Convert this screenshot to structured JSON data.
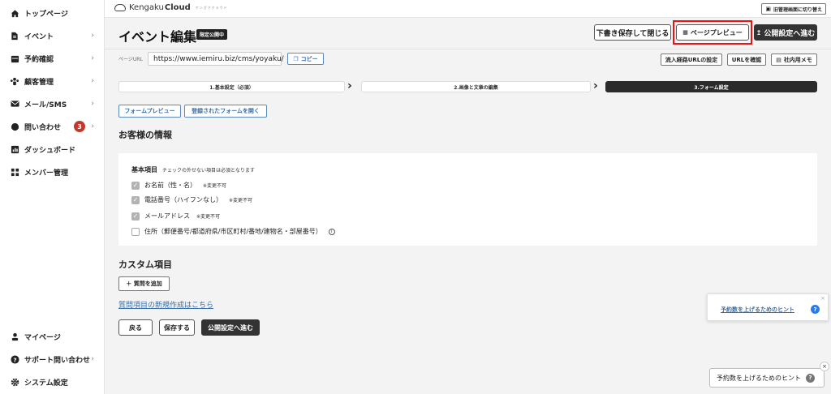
{
  "sidebar": {
    "items": [
      {
        "label": "トップページ",
        "icon": "home-icon"
      },
      {
        "label": "イベント",
        "icon": "document-icon"
      },
      {
        "label": "予約確認",
        "icon": "calendar-icon"
      },
      {
        "label": "顧客管理",
        "icon": "users-icon"
      },
      {
        "label": "メール/SMS",
        "icon": "mail-icon"
      },
      {
        "label": "問い合わせ",
        "icon": "chat-icon",
        "badge": "3"
      },
      {
        "label": "ダッシュボード",
        "icon": "chart-icon"
      },
      {
        "label": "メンバー管理",
        "icon": "grid-icon"
      }
    ],
    "bottom_items": [
      {
        "label": "マイページ",
        "icon": "person-icon"
      },
      {
        "label": "サポート問い合わせ",
        "icon": "help-icon"
      },
      {
        "label": "システム設定",
        "icon": "gear-icon"
      }
    ]
  },
  "topbar": {
    "logo_prefix": "Kengaku",
    "logo_bold": "Cloud",
    "logo_sub": "ケンガククラウド",
    "old_admin_label": "旧管理画面に切り替え"
  },
  "header": {
    "title": "イベント編集",
    "status_badge": "限定公開中",
    "save_draft_label": "下書き保存して閉じる",
    "preview_label": "ページプレビュー",
    "publish_settings_label": "公開設定へ進む"
  },
  "url_row": {
    "label": "ページURL",
    "value": "https://www.iemiru.biz/cms/yoyaku/",
    "copy_label": "コピー",
    "inflow_label": "流入経路URLの設定",
    "check_url_label": "URLを確認",
    "memo_label": "社内用メモ"
  },
  "steps": [
    {
      "label": "1.基本設定（必須）"
    },
    {
      "label": "2.画像と文章の編集"
    },
    {
      "label": "3.フォーム設定"
    }
  ],
  "form_buttons": {
    "preview_label": "フォームプレビュー",
    "open_registered_label": "登録されたフォームを開く"
  },
  "customer_info": {
    "title": "お客様の情報",
    "basic_title": "基本項目",
    "basic_note": "チェックの外せない項目は必須となります",
    "fields": [
      {
        "label": "お名前（性・名）",
        "note": "※変更不可",
        "checked": true
      },
      {
        "label": "電話番号（ハイフンなし）",
        "note": "※変更不可",
        "checked": true
      },
      {
        "label": "メールアドレス",
        "note": "※変更不可",
        "checked": true
      },
      {
        "label": "住所（郵便番号/都道府県/市区町村/番地/建物名・部屋番号）",
        "note": "",
        "checked": false
      }
    ]
  },
  "custom": {
    "title": "カスタム項目",
    "add_question_label": "＋ 質問を追加",
    "new_item_link": "質問項目の新規作成はこちら"
  },
  "footer_buttons": {
    "back_label": "戻る",
    "save_label": "保存する",
    "publish_label": "公開設定へ進む"
  },
  "hints": {
    "hint_link": "予約数を上げるためのヒント",
    "hint_button": "予約数を上げるためのヒント"
  },
  "colors": {
    "accent_blue": "#3b6ea5",
    "highlight_red": "#e11111",
    "badge_red": "#c0392b",
    "dark": "#2b2b2b"
  }
}
